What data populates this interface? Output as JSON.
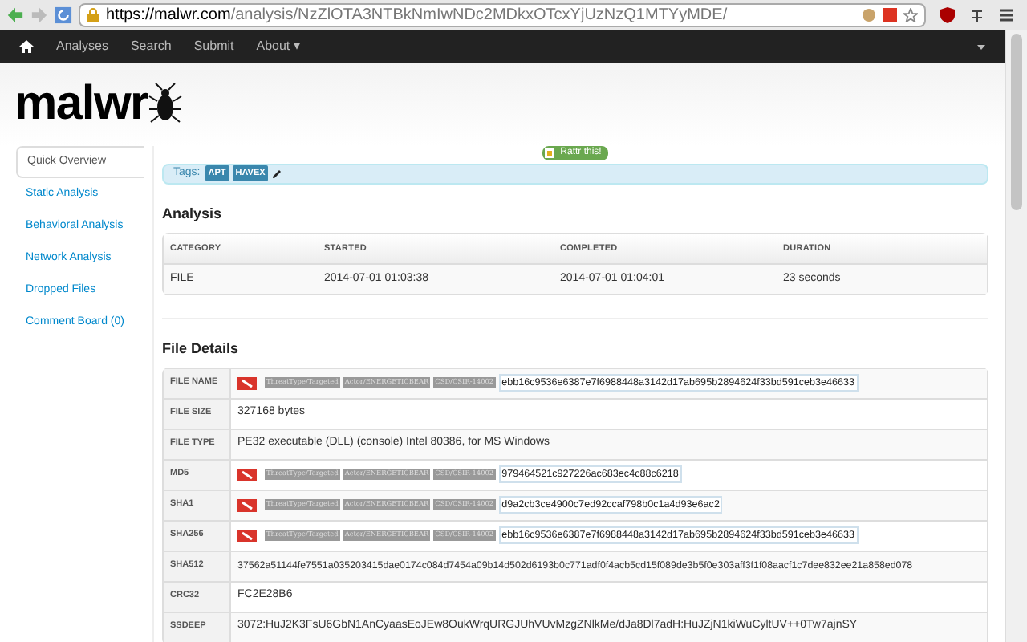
{
  "browser": {
    "url_host": "https://malwr.com",
    "url_path": "/analysis/NzZlOTA3NTBkNmIwNDc2MDkxOTcxYjUzNzQ1MTYyMDE/"
  },
  "navbar": {
    "items": [
      "Analyses",
      "Search",
      "Submit",
      "About ▾"
    ]
  },
  "logo": "malwr",
  "sidebar": {
    "items": [
      {
        "label": "Quick Overview",
        "selected": true
      },
      {
        "label": "Static Analysis",
        "selected": false
      },
      {
        "label": "Behavioral Analysis",
        "selected": false
      },
      {
        "label": "Network Analysis",
        "selected": false
      },
      {
        "label": "Dropped Files",
        "selected": false
      },
      {
        "label": "Comment Board (0)",
        "selected": false
      }
    ]
  },
  "rate_button": "Rattr this!",
  "tags": {
    "label": "Tags:",
    "items": [
      "APT",
      "HAVEX"
    ]
  },
  "analysis": {
    "title": "Analysis",
    "columns": [
      "CATEGORY",
      "STARTED",
      "COMPLETED",
      "DURATION"
    ],
    "rows": [
      [
        "FILE",
        "2014-07-01 01:03:38",
        "2014-07-01 01:04:01",
        "23 seconds"
      ]
    ]
  },
  "file_details": {
    "title": "File Details",
    "rows": [
      {
        "label": "FILE NAME",
        "kind": "tagged",
        "tags": [
          "ThreatType/Targeted",
          "Actor/ENERGETICBEAR",
          "CSD/CSIR-14002"
        ],
        "value": "ebb16c9536e6387e7f6988448a3142d17ab695b2894624f33bd591ceb3e46633"
      },
      {
        "label": "FILE SIZE",
        "kind": "text",
        "value": "327168 bytes"
      },
      {
        "label": "FILE TYPE",
        "kind": "text",
        "value": "PE32 executable (DLL) (console) Intel 80386, for MS Windows"
      },
      {
        "label": "MD5",
        "kind": "tagged",
        "tags": [
          "ThreatType/Targeted",
          "Actor/ENERGETICBEAR",
          "CSD/CSIR-14002"
        ],
        "value": "979464521c927226ac683ec4c88c6218"
      },
      {
        "label": "SHA1",
        "kind": "tagged",
        "tags": [
          "ThreatType/Targeted",
          "Actor/ENERGETICBEAR",
          "CSD/CSIR-14002"
        ],
        "value": "d9a2cb3ce4900c7ed92ccaf798b0c1a4d93e6ac2"
      },
      {
        "label": "SHA256",
        "kind": "tagged",
        "tags": [
          "ThreatType/Targeted",
          "Actor/ENERGETICBEAR",
          "CSD/CSIR-14002"
        ],
        "value": "ebb16c9536e6387e7f6988448a3142d17ab695b2894624f33bd591ceb3e46633"
      },
      {
        "label": "SHA512",
        "kind": "text",
        "value": "37562a51144fe7551a035203415dae0174c084d7454a09b14d502d6193b0c771adf0f4acb5cd15f089de3b5f0e303aff3f1f08aacf1c7dee832ee21a858ed078"
      },
      {
        "label": "CRC32",
        "kind": "text",
        "value": "FC2E28B6"
      },
      {
        "label": "SSDEEP",
        "kind": "text",
        "value": "3072:HuJ2K3FsU6GbN1AnCyaasEoJEw8OukWrqURGJUhVUvMzgZNlkMe/dJa8Dl7adH:HuJZjN1kiWuCyltUV++0Tw7ajnSY"
      }
    ]
  }
}
